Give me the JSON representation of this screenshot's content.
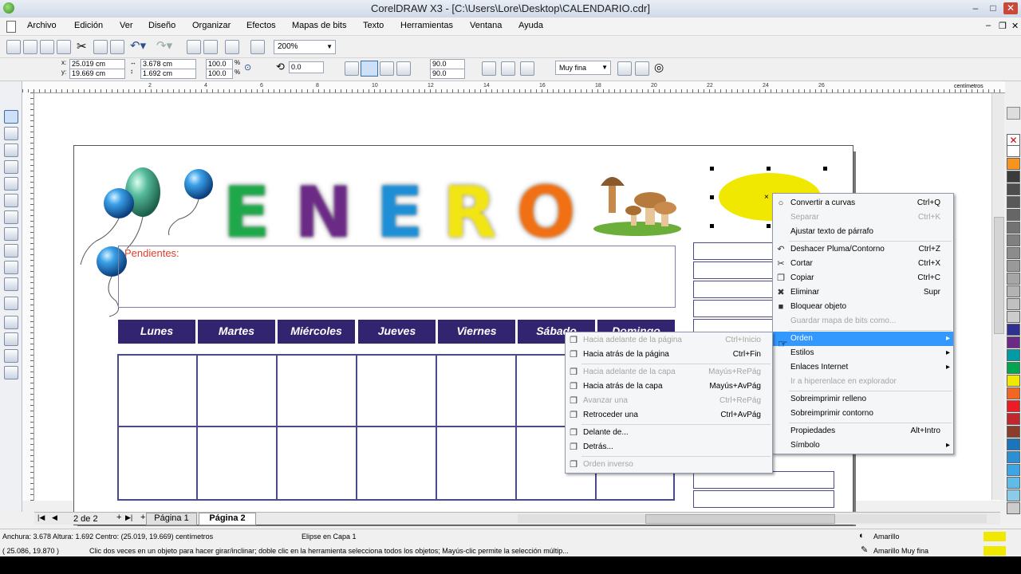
{
  "window": {
    "title": "CorelDRAW X3 - [C:\\Users\\Lore\\Desktop\\CALENDARIO.cdr]"
  },
  "menubar": [
    "Archivo",
    "Edición",
    "Ver",
    "Diseño",
    "Organizar",
    "Efectos",
    "Mapas de bits",
    "Texto",
    "Herramientas",
    "Ventana",
    "Ayuda"
  ],
  "toolbar": {
    "zoom": "200%",
    "pos_x": "25.019 cm",
    "pos_y": "19.669 cm",
    "width": "3.678 cm",
    "height": "1.692 cm",
    "scale_x": "100.0",
    "scale_y": "100.0",
    "scale_unit": "%",
    "rotation": "0.0",
    "angle_start": "90.0",
    "angle_end": "90.0",
    "outline": "Muy fina",
    "x_label": "x:",
    "y_label": "y:"
  },
  "ruler": {
    "ticks": [
      "2",
      "4",
      "6",
      "8",
      "10",
      "12",
      "14",
      "16",
      "18",
      "20",
      "22",
      "24",
      "26"
    ],
    "unit": "centímetros"
  },
  "calendar": {
    "month_letters": [
      "E",
      "N",
      "E",
      "R",
      "O"
    ],
    "month_colors": [
      "#1fa84a",
      "#6b2a86",
      "#1e8fd6",
      "#f2e514",
      "#f07013"
    ],
    "pendientes": "Pendientes:",
    "days": [
      "Lunes",
      "Martes",
      "Miércoles",
      "Jueves",
      "Viernes",
      "Sábado",
      "Domingo"
    ]
  },
  "context_menu": {
    "items": [
      {
        "label": "Convertir a curvas",
        "shortcut": "Ctrl+Q",
        "icon": "convert-curves-icon",
        "enabled": true
      },
      {
        "label": "Separar",
        "shortcut": "Ctrl+K",
        "icon": "",
        "enabled": false
      },
      {
        "label": "Ajustar texto de párrafo",
        "shortcut": "",
        "icon": "",
        "enabled": true
      },
      {
        "label": "Deshacer Pluma/Contorno",
        "shortcut": "Ctrl+Z",
        "icon": "undo-icon",
        "enabled": true
      },
      {
        "label": "Cortar",
        "shortcut": "Ctrl+X",
        "icon": "cut-icon",
        "enabled": true
      },
      {
        "label": "Copiar",
        "shortcut": "Ctrl+C",
        "icon": "copy-icon",
        "enabled": true
      },
      {
        "label": "Eliminar",
        "shortcut": "Supr",
        "icon": "delete-icon",
        "enabled": true
      },
      {
        "label": "Bloquear objeto",
        "shortcut": "",
        "icon": "lock-icon",
        "enabled": true
      },
      {
        "label": "Guardar mapa de bits como...",
        "shortcut": "",
        "icon": "",
        "enabled": false
      },
      {
        "label": "Orden",
        "shortcut": "",
        "icon": "",
        "enabled": true,
        "submenu": true,
        "highlighted": true
      },
      {
        "label": "Estilos",
        "shortcut": "",
        "icon": "",
        "enabled": true,
        "submenu": true
      },
      {
        "label": "Enlaces Internet",
        "shortcut": "",
        "icon": "",
        "enabled": true,
        "submenu": true
      },
      {
        "label": "Ir a hiperenlace en explorador",
        "shortcut": "",
        "icon": "",
        "enabled": false
      },
      {
        "label": "Sobreimprimir relleno",
        "shortcut": "",
        "icon": "",
        "enabled": true
      },
      {
        "label": "Sobreimprimir contorno",
        "shortcut": "",
        "icon": "",
        "enabled": true
      },
      {
        "label": "Propiedades",
        "shortcut": "Alt+Intro",
        "icon": "",
        "enabled": true
      },
      {
        "label": "Símbolo",
        "shortcut": "",
        "icon": "",
        "enabled": true,
        "submenu": true
      }
    ]
  },
  "order_submenu": {
    "items": [
      {
        "label": "Hacia adelante de la página",
        "shortcut": "Ctrl+Inicio",
        "enabled": false
      },
      {
        "label": "Hacia atrás de la página",
        "shortcut": "Ctrl+Fin",
        "enabled": true
      },
      {
        "label": "Hacia adelante de la capa",
        "shortcut": "Mayús+RePág",
        "enabled": false
      },
      {
        "label": "Hacia atrás de la capa",
        "shortcut": "Mayús+AvPág",
        "enabled": true
      },
      {
        "label": "Avanzar una",
        "shortcut": "Ctrl+RePág",
        "enabled": false
      },
      {
        "label": "Retroceder una",
        "shortcut": "Ctrl+AvPág",
        "enabled": true
      },
      {
        "label": "Delante de...",
        "shortcut": "",
        "enabled": true
      },
      {
        "label": "Detrás...",
        "shortcut": "",
        "enabled": true
      },
      {
        "label": "Orden inverso",
        "shortcut": "",
        "enabled": false
      }
    ]
  },
  "pages": {
    "counter": "2 de 2",
    "tabs": [
      "Página 1",
      "Página 2"
    ],
    "active": "Página 2"
  },
  "status": {
    "line1": "Anchura: 3.678  Altura: 1.692  Centro: (25.019, 19.669)  centímetros",
    "object_info": "Elipse en Capa 1",
    "line2": "( 25.086, 19.870 )",
    "hint": "Clic dos veces en un objeto para hacer girar/inclinar; doble clic en la herramienta selecciona todos los objetos; Mayús-clic permite la selección múltip...",
    "fill_label": "Amarillo",
    "outline_label": "Amarillo Muy fina",
    "fill_color": "#f0e800"
  },
  "palette_colors": [
    "#ffffff",
    "#f7941d",
    "#3b3b3b",
    "#4d4d4d",
    "#595959",
    "#666666",
    "#737373",
    "#808080",
    "#8c8c8c",
    "#999999",
    "#a6a6a6",
    "#b3b3b3",
    "#c0c0c0",
    "#cccccc",
    "#2e3192",
    "#6b2a86",
    "#009ba4",
    "#00a650",
    "#f0e800",
    "#f26522",
    "#ed1c24",
    "#c1272d",
    "#8b3d2b",
    "#1b75bc",
    "#2b8fd6",
    "#3ba5e6",
    "#5fbbe8",
    "#8ccbe8",
    "#cccccc"
  ]
}
